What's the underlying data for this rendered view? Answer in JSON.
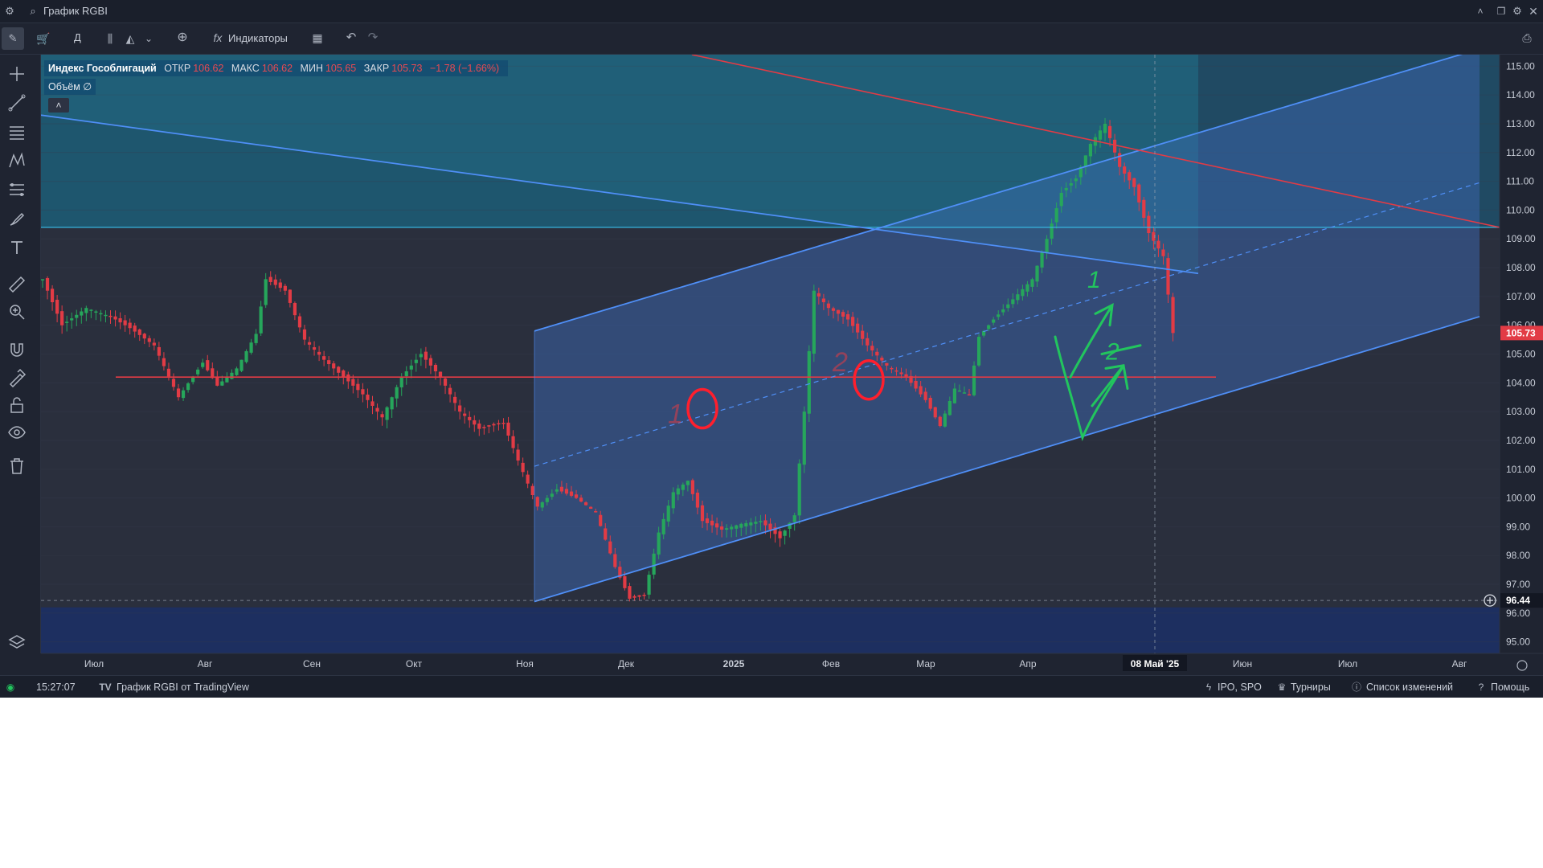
{
  "window": {
    "title": "График RGBI",
    "controls": [
      "collapse-icon",
      "restore-icon",
      "settings-icon",
      "close-icon"
    ]
  },
  "toolbar": {
    "indicators_label": "Индикаторы",
    "timeframe_label": "Д"
  },
  "legend": {
    "instrument": "Индекс Гособлигаций",
    "open_label": "ОТКР",
    "open_value": "106.62",
    "high_label": "МАКС",
    "high_value": "106.62",
    "low_label": "МИН",
    "low_value": "105.65",
    "close_label": "ЗАКР",
    "close_value": "105.73",
    "change_value": "−1.78 (−1.66%)",
    "volume_label": "Объём ∅",
    "collapse_glyph": "˄"
  },
  "colors": {
    "background": "#2a2f3d",
    "up_candle": "#26a65b",
    "down_candle": "#e23b45",
    "channel_line": "#4f8ff7",
    "channel_fill": "#3b63a8",
    "red_line": "#e23b45",
    "cyan_line": "#36b7e0",
    "green_drawing": "#22c55e"
  },
  "annotations": {
    "marker_1": "1",
    "marker_2": "2",
    "arrow_1": "1",
    "arrow_2": "2"
  },
  "chart_data": {
    "type": "candlestick",
    "price_axis_labels": [
      "115.00",
      "114.00",
      "113.00",
      "112.00",
      "111.00",
      "110.00",
      "109.00",
      "108.00",
      "107.00",
      "106.00",
      "105.00",
      "104.00",
      "103.00",
      "102.00",
      "101.00",
      "100.00",
      "99.00",
      "98.00",
      "97.00",
      "96.00",
      "95.00"
    ],
    "price_range": [
      94.6,
      115.4
    ],
    "current_price_label": "105.73",
    "crosshair_price_label": "96.44",
    "time_axis_labels": [
      "Июл",
      "Авг",
      "Сен",
      "Окт",
      "Ноя",
      "Дек",
      "2025",
      "Фев",
      "Мар",
      "Апр",
      "М",
      "Июн",
      "Июл",
      "Авг"
    ],
    "crosshair_time_label": "08 Май '25",
    "horizontal_levels": [
      104.2,
      109.4
    ],
    "price_path": [
      [
        0,
        107.6
      ],
      [
        4,
        106.0
      ],
      [
        9,
        106.6
      ],
      [
        14,
        106.3
      ],
      [
        18,
        105.9
      ],
      [
        23,
        105.3
      ],
      [
        28,
        103.5
      ],
      [
        33,
        104.7
      ],
      [
        36,
        103.9
      ],
      [
        40,
        104.5
      ],
      [
        44,
        105.7
      ],
      [
        46,
        107.6
      ],
      [
        50,
        107.2
      ],
      [
        54,
        105.5
      ],
      [
        58,
        104.8
      ],
      [
        62,
        104.2
      ],
      [
        66,
        103.6
      ],
      [
        70,
        102.8
      ],
      [
        74,
        104.2
      ],
      [
        78,
        105.0
      ],
      [
        82,
        104.2
      ],
      [
        86,
        103.0
      ],
      [
        90,
        102.4
      ],
      [
        95,
        102.6
      ],
      [
        98,
        101.3
      ],
      [
        102,
        99.7
      ],
      [
        106,
        100.3
      ],
      [
        110,
        100.0
      ],
      [
        114,
        99.5
      ],
      [
        118,
        97.6
      ],
      [
        121,
        96.5
      ],
      [
        124,
        96.6
      ],
      [
        127,
        98.8
      ],
      [
        130,
        100.2
      ],
      [
        133,
        100.6
      ],
      [
        136,
        99.2
      ],
      [
        140,
        98.9
      ],
      [
        144,
        99.1
      ],
      [
        148,
        99.2
      ],
      [
        152,
        98.6
      ],
      [
        155,
        99.4
      ],
      [
        157,
        103.0
      ],
      [
        159,
        107.2
      ],
      [
        162,
        106.6
      ],
      [
        166,
        106.2
      ],
      [
        170,
        105.3
      ],
      [
        174,
        104.6
      ],
      [
        178,
        104.2
      ],
      [
        182,
        103.4
      ],
      [
        185,
        102.5
      ],
      [
        188,
        103.8
      ],
      [
        191,
        103.6
      ],
      [
        193,
        105.6
      ],
      [
        196,
        106.2
      ],
      [
        200,
        106.9
      ],
      [
        204,
        107.6
      ],
      [
        207,
        109.0
      ],
      [
        210,
        110.6
      ],
      [
        213,
        111.1
      ],
      [
        216,
        112.3
      ],
      [
        219,
        113.0
      ],
      [
        222,
        111.5
      ],
      [
        225,
        110.8
      ],
      [
        228,
        109.2
      ],
      [
        231,
        108.4
      ],
      [
        233,
        105.73
      ]
    ]
  },
  "status": {
    "time": "15:27:07",
    "source_label": "График RGBI от TradingView",
    "ipo_label": "IPO, SPO",
    "tournaments_label": "Турниры",
    "changelog_label": "Список изменений",
    "help_label": "Помощь"
  }
}
